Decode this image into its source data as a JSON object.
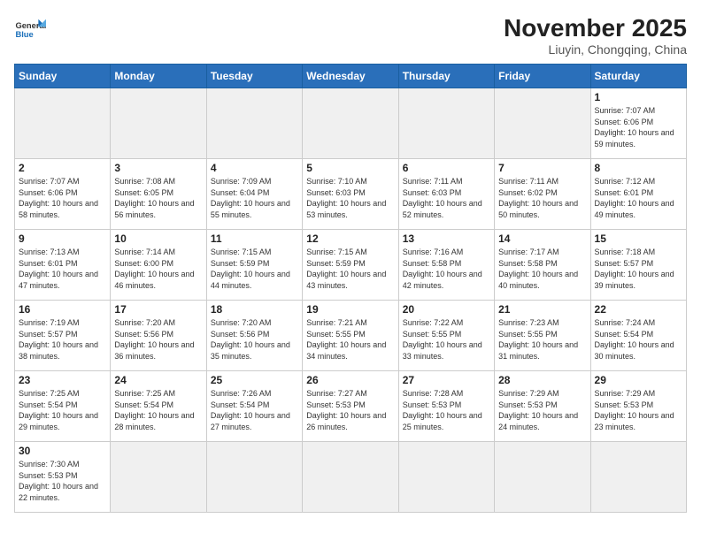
{
  "header": {
    "logo_general": "General",
    "logo_blue": "Blue",
    "month_title": "November 2025",
    "location": "Liuyin, Chongqing, China"
  },
  "days_of_week": [
    "Sunday",
    "Monday",
    "Tuesday",
    "Wednesday",
    "Thursday",
    "Friday",
    "Saturday"
  ],
  "weeks": [
    [
      {
        "day": "",
        "empty": true
      },
      {
        "day": "",
        "empty": true
      },
      {
        "day": "",
        "empty": true
      },
      {
        "day": "",
        "empty": true
      },
      {
        "day": "",
        "empty": true
      },
      {
        "day": "",
        "empty": true
      },
      {
        "day": "1",
        "sunrise": "7:07 AM",
        "sunset": "6:06 PM",
        "daylight": "10 hours and 59 minutes."
      }
    ],
    [
      {
        "day": "2",
        "sunrise": "7:07 AM",
        "sunset": "6:06 PM",
        "daylight": "10 hours and 58 minutes."
      },
      {
        "day": "3",
        "sunrise": "7:08 AM",
        "sunset": "6:05 PM",
        "daylight": "10 hours and 56 minutes."
      },
      {
        "day": "4",
        "sunrise": "7:09 AM",
        "sunset": "6:04 PM",
        "daylight": "10 hours and 55 minutes."
      },
      {
        "day": "5",
        "sunrise": "7:10 AM",
        "sunset": "6:03 PM",
        "daylight": "10 hours and 53 minutes."
      },
      {
        "day": "6",
        "sunrise": "7:11 AM",
        "sunset": "6:03 PM",
        "daylight": "10 hours and 52 minutes."
      },
      {
        "day": "7",
        "sunrise": "7:11 AM",
        "sunset": "6:02 PM",
        "daylight": "10 hours and 50 minutes."
      },
      {
        "day": "8",
        "sunrise": "7:12 AM",
        "sunset": "6:01 PM",
        "daylight": "10 hours and 49 minutes."
      }
    ],
    [
      {
        "day": "9",
        "sunrise": "7:13 AM",
        "sunset": "6:01 PM",
        "daylight": "10 hours and 47 minutes."
      },
      {
        "day": "10",
        "sunrise": "7:14 AM",
        "sunset": "6:00 PM",
        "daylight": "10 hours and 46 minutes."
      },
      {
        "day": "11",
        "sunrise": "7:15 AM",
        "sunset": "5:59 PM",
        "daylight": "10 hours and 44 minutes."
      },
      {
        "day": "12",
        "sunrise": "7:15 AM",
        "sunset": "5:59 PM",
        "daylight": "10 hours and 43 minutes."
      },
      {
        "day": "13",
        "sunrise": "7:16 AM",
        "sunset": "5:58 PM",
        "daylight": "10 hours and 42 minutes."
      },
      {
        "day": "14",
        "sunrise": "7:17 AM",
        "sunset": "5:58 PM",
        "daylight": "10 hours and 40 minutes."
      },
      {
        "day": "15",
        "sunrise": "7:18 AM",
        "sunset": "5:57 PM",
        "daylight": "10 hours and 39 minutes."
      }
    ],
    [
      {
        "day": "16",
        "sunrise": "7:19 AM",
        "sunset": "5:57 PM",
        "daylight": "10 hours and 38 minutes."
      },
      {
        "day": "17",
        "sunrise": "7:20 AM",
        "sunset": "5:56 PM",
        "daylight": "10 hours and 36 minutes."
      },
      {
        "day": "18",
        "sunrise": "7:20 AM",
        "sunset": "5:56 PM",
        "daylight": "10 hours and 35 minutes."
      },
      {
        "day": "19",
        "sunrise": "7:21 AM",
        "sunset": "5:55 PM",
        "daylight": "10 hours and 34 minutes."
      },
      {
        "day": "20",
        "sunrise": "7:22 AM",
        "sunset": "5:55 PM",
        "daylight": "10 hours and 33 minutes."
      },
      {
        "day": "21",
        "sunrise": "7:23 AM",
        "sunset": "5:55 PM",
        "daylight": "10 hours and 31 minutes."
      },
      {
        "day": "22",
        "sunrise": "7:24 AM",
        "sunset": "5:54 PM",
        "daylight": "10 hours and 30 minutes."
      }
    ],
    [
      {
        "day": "23",
        "sunrise": "7:25 AM",
        "sunset": "5:54 PM",
        "daylight": "10 hours and 29 minutes."
      },
      {
        "day": "24",
        "sunrise": "7:25 AM",
        "sunset": "5:54 PM",
        "daylight": "10 hours and 28 minutes."
      },
      {
        "day": "25",
        "sunrise": "7:26 AM",
        "sunset": "5:54 PM",
        "daylight": "10 hours and 27 minutes."
      },
      {
        "day": "26",
        "sunrise": "7:27 AM",
        "sunset": "5:53 PM",
        "daylight": "10 hours and 26 minutes."
      },
      {
        "day": "27",
        "sunrise": "7:28 AM",
        "sunset": "5:53 PM",
        "daylight": "10 hours and 25 minutes."
      },
      {
        "day": "28",
        "sunrise": "7:29 AM",
        "sunset": "5:53 PM",
        "daylight": "10 hours and 24 minutes."
      },
      {
        "day": "29",
        "sunrise": "7:29 AM",
        "sunset": "5:53 PM",
        "daylight": "10 hours and 23 minutes."
      }
    ],
    [
      {
        "day": "30",
        "sunrise": "7:30 AM",
        "sunset": "5:53 PM",
        "daylight": "10 hours and 22 minutes."
      },
      {
        "day": "",
        "empty": true
      },
      {
        "day": "",
        "empty": true
      },
      {
        "day": "",
        "empty": true
      },
      {
        "day": "",
        "empty": true
      },
      {
        "day": "",
        "empty": true
      },
      {
        "day": "",
        "empty": true
      }
    ]
  ]
}
